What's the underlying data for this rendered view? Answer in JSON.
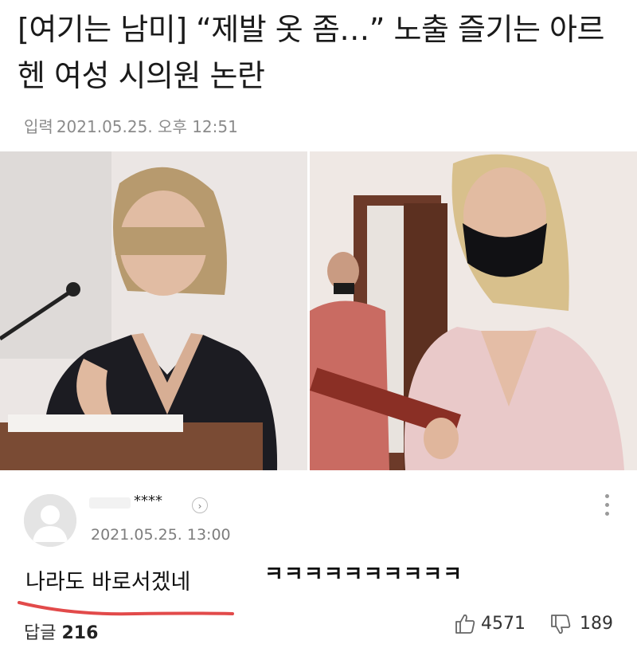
{
  "article": {
    "headline": "[여기는 남미] “제발 옷 좀…” 노출 즐기는 아르헨 여성 시의원 논란",
    "date_label": "입력",
    "date_value": "2021.05.25. 오후 12:51"
  },
  "comment": {
    "username": "****",
    "date": "2021.05.25. 13:00",
    "text": "나라도 바로서겠네",
    "reaction_text": "ㅋㅋㅋㅋㅋㅋㅋㅋㅋㅋ",
    "replies_label": "답글",
    "replies_count": "216",
    "likes": "4571",
    "dislikes": "189"
  },
  "colors": {
    "underline": "#e24a4a",
    "meta_gray": "#8b8b8b"
  },
  "icons": {
    "profile_chevron": "chevron-right-icon",
    "more": "kebab-menu-icon",
    "like": "thumbs-up-icon",
    "dislike": "thumbs-down-icon"
  }
}
